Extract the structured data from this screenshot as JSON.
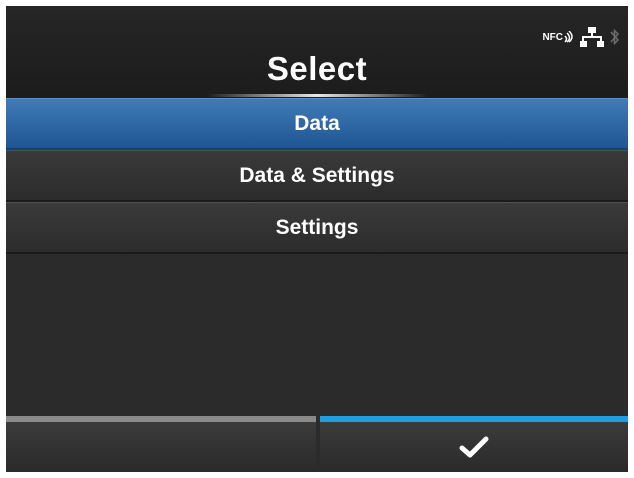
{
  "header": {
    "title": "Select",
    "status_icons": {
      "nfc_label": "NFC",
      "network": "network-icon",
      "bluetooth": "bluetooth-icon"
    }
  },
  "menu": {
    "items": [
      {
        "label": "Data",
        "selected": true
      },
      {
        "label": "Data & Settings",
        "selected": false
      },
      {
        "label": "Settings",
        "selected": false
      }
    ]
  },
  "footer": {
    "left_key": "",
    "right_key_icon": "checkmark-icon"
  },
  "colors": {
    "selected": "#2a64a4",
    "confirm_accent": "#1e9fe3",
    "inactive_accent": "#8a8a8a",
    "background": "#2b2b2b"
  }
}
